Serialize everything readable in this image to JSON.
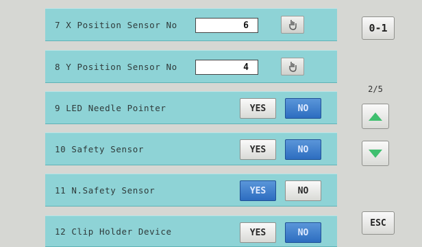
{
  "rows": [
    {
      "label": "7 X Position Sensor No",
      "value": "6"
    },
    {
      "label": "8 Y Position Sensor No",
      "value": "4"
    },
    {
      "label": "9 LED Needle Pointer",
      "yes": "YES",
      "no": "NO",
      "selected": "NO"
    },
    {
      "label": "10 Safety Sensor",
      "yes": "YES",
      "no": "NO",
      "selected": "NO"
    },
    {
      "label": "11 N.Safety Sensor",
      "yes": "YES",
      "no": "NO",
      "selected": "YES"
    },
    {
      "label": "12 Clip Holder Device",
      "yes": "YES",
      "no": "NO",
      "selected": "NO"
    }
  ],
  "sidebar": {
    "top_button_icon": "0-1",
    "page_indicator": "2/5",
    "up_icon": "arrow-up-icon",
    "down_icon": "arrow-down-icon",
    "esc_label": "ESC"
  },
  "colors": {
    "panel": "#8ed3d6",
    "selected_button": "#2d6dc0",
    "background": "#d6d7d3",
    "arrow": "#3fbf6f"
  }
}
